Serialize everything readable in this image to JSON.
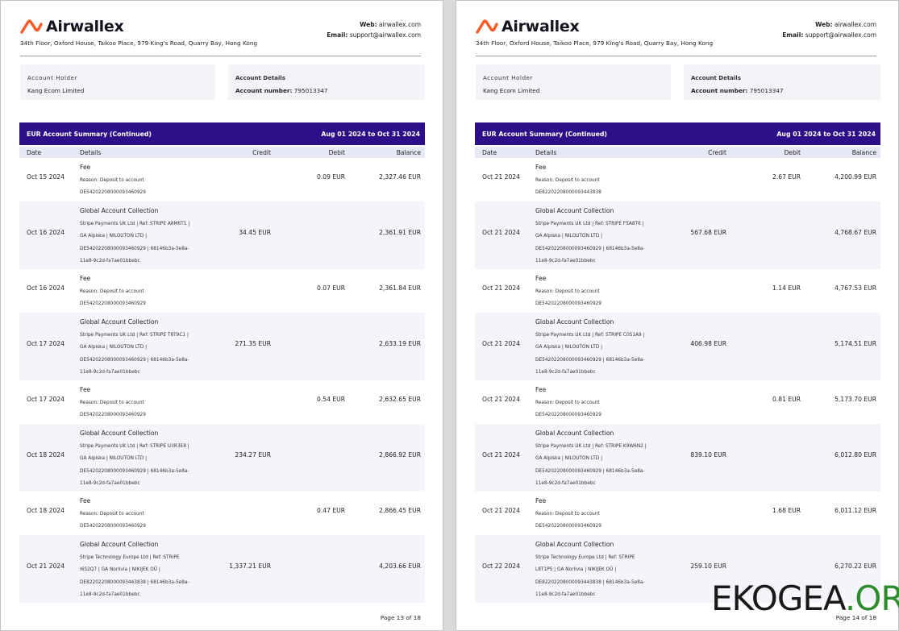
{
  "brand": {
    "name": "Airwallex",
    "address": "34th Floor, Oxford House, Taikoo Place, 979 King's Road, Quarry Bay, Hong Kong",
    "web_label": "Web:",
    "web": "airwallex.com",
    "email_label": "Email:",
    "email": "support@airwallex.com",
    "accent_color": "#fa5a28"
  },
  "account": {
    "holder_label": "Account Holder",
    "holder": "Kang Ecom Limited",
    "details_label": "Account Details",
    "number_label": "Account number:",
    "number": "795013347"
  },
  "summary": {
    "title": "EUR Account Summary (Continued)",
    "period": "Aug 01 2024 to Oct 31 2024",
    "bar_color": "#2e0f8a"
  },
  "columns": {
    "date": "Date",
    "details": "Details",
    "credit": "Credit",
    "debit": "Debit",
    "balance": "Balance"
  },
  "pages": [
    {
      "page_label": "Page 13 of 18",
      "rows": [
        {
          "type": "fee",
          "date": "Oct 15 2024",
          "title": "Fee",
          "lines": [
            "Reason: Deposit to account",
            "DE54202208000093460929"
          ],
          "credit": "",
          "debit": "0.09 EUR",
          "balance": "2,327.46 EUR"
        },
        {
          "type": "gac",
          "date": "Oct 16 2024",
          "title": "Global Account Collection",
          "lines": [
            "Stripe Payments UK Ltd | Ref: STRIPE A8M6T1 |",
            "GA Alpiska | NILOUTON LTD |",
            "DE54202208000093460929 | 68146b3a-5e8a-",
            "11e8-9c2d-fa7ae01bbebc"
          ],
          "credit": "34.45 EUR",
          "debit": "",
          "balance": "2,361.91 EUR"
        },
        {
          "type": "fee",
          "date": "Oct 16 2024",
          "title": "Fee",
          "lines": [
            "Reason: Deposit to account",
            "DE54202208000093460929"
          ],
          "credit": "",
          "debit": "0.07 EUR",
          "balance": "2,361.84 EUR"
        },
        {
          "type": "gac",
          "date": "Oct 17 2024",
          "title": "Global Account Collection",
          "lines": [
            "Stripe Payments UK Ltd | Ref: STRIPE T8T9C1 |",
            "GA Alpiska | NILOUTON LTD |",
            "DE54202208000093460929 | 68146b3a-5e8a-",
            "11e8-9c2d-fa7ae01bbebc"
          ],
          "credit": "271.35 EUR",
          "debit": "",
          "balance": "2,633.19 EUR"
        },
        {
          "type": "fee",
          "date": "Oct 17 2024",
          "title": "Fee",
          "lines": [
            "Reason: Deposit to account",
            "DE54202208000093460929"
          ],
          "credit": "",
          "debit": "0.54 EUR",
          "balance": "2,632.65 EUR"
        },
        {
          "type": "gac",
          "date": "Oct 18 2024",
          "title": "Global Account Collection",
          "lines": [
            "Stripe Payments UK Ltd | Ref: STRIPE U3R3E8 |",
            "GA Alpiska | NILOUTON LTD |",
            "DE54202208000093460929 | 68146b3a-5e8a-",
            "11e8-9c2d-fa7ae01bbebc"
          ],
          "credit": "234.27 EUR",
          "debit": "",
          "balance": "2,866.92 EUR"
        },
        {
          "type": "fee",
          "date": "Oct 18 2024",
          "title": "Fee",
          "lines": [
            "Reason: Deposit to account",
            "DE54202208000093460929"
          ],
          "credit": "",
          "debit": "0.47 EUR",
          "balance": "2,866.45 EUR"
        },
        {
          "type": "gac",
          "date": "Oct 21 2024",
          "title": "Global Account Collection",
          "lines": [
            "Stripe Technology Europe Ltd | Ref: STRIPE",
            "I6S2Q7 | GA Norlivia | NIKIJEK OÜ |",
            "DE82202208000093443838 | 68146b3a-5e8a-",
            "11e8-9c2d-fa7ae01bbebc"
          ],
          "credit": "1,337.21 EUR",
          "debit": "",
          "balance": "4,203.66 EUR"
        }
      ]
    },
    {
      "page_label": "Page 14 of 18",
      "rows": [
        {
          "type": "fee",
          "date": "Oct 21 2024",
          "title": "Fee",
          "lines": [
            "Reason: Deposit to account",
            "DE82202208000093443838"
          ],
          "credit": "",
          "debit": "2.67 EUR",
          "balance": "4,200.99 EUR"
        },
        {
          "type": "gac",
          "date": "Oct 21 2024",
          "title": "Global Account Collection",
          "lines": [
            "Stripe Payments UK Ltd | Ref: STRIPE F5A8T6 |",
            "GA Alpiska | NILOUTON LTD |",
            "DE54202208000093460929 | 68146b3a-5e8a-",
            "11e8-9c2d-fa7ae01bbebc"
          ],
          "credit": "567.68 EUR",
          "debit": "",
          "balance": "4,768.67 EUR"
        },
        {
          "type": "fee",
          "date": "Oct 21 2024",
          "title": "Fee",
          "lines": [
            "Reason: Deposit to account",
            "DE54202208000093460929"
          ],
          "credit": "",
          "debit": "1.14 EUR",
          "balance": "4,767.53 EUR"
        },
        {
          "type": "gac",
          "date": "Oct 21 2024",
          "title": "Global Account Collection",
          "lines": [
            "Stripe Payments UK Ltd | Ref: STRIPE C0S1A9 |",
            "GA Alpiska | NILOUTON LTD |",
            "DE54202208000093460929 | 68146b3a-5e8a-",
            "11e8-9c2d-fa7ae01bbebc"
          ],
          "credit": "406.98 EUR",
          "debit": "",
          "balance": "5,174.51 EUR"
        },
        {
          "type": "fee",
          "date": "Oct 21 2024",
          "title": "Fee",
          "lines": [
            "Reason: Deposit to account",
            "DE54202208000093460929"
          ],
          "credit": "",
          "debit": "0.81 EUR",
          "balance": "5,173.70 EUR"
        },
        {
          "type": "gac",
          "date": "Oct 21 2024",
          "title": "Global Account Collection",
          "lines": [
            "Stripe Payments UK Ltd | Ref: STRIPE K9W6N2 |",
            "GA Alpiska | NILOUTON LTD |",
            "DE54202208000093460929 | 68146b3a-5e8a-",
            "11e8-9c2d-fa7ae01bbebc"
          ],
          "credit": "839.10 EUR",
          "debit": "",
          "balance": "6,012.80 EUR"
        },
        {
          "type": "fee",
          "date": "Oct 21 2024",
          "title": "Fee",
          "lines": [
            "Reason: Deposit to account",
            "DE54202208000093460929"
          ],
          "credit": "",
          "debit": "1.68 EUR",
          "balance": "6,011.12 EUR"
        },
        {
          "type": "gac",
          "date": "Oct 22 2024",
          "title": "Global Account Collection",
          "lines": [
            "Stripe Technology Europe Ltd | Ref: STRIPE",
            "L8T1P5 | GA Norlivia | NIKIJEK OÜ |",
            "DE82202208000093443838 | 68146b3a-5e8a-",
            "11e8-9c2d-fa7ae01bbebc"
          ],
          "credit": "259.10 EUR",
          "debit": "",
          "balance": "6,270.22 EUR"
        }
      ]
    }
  ],
  "watermark": {
    "name": "EKOGEA",
    "tld": ".ORG"
  }
}
